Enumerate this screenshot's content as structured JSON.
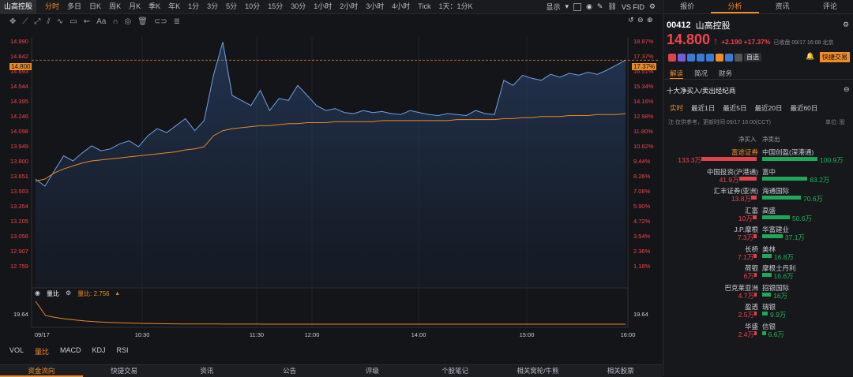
{
  "topbar": {
    "stock_title": "山高控股",
    "timeframes": [
      "分时",
      "多日",
      "日K",
      "周K",
      "月K",
      "季K",
      "年K",
      "1分",
      "3分",
      "5分",
      "10分",
      "15分",
      "30分",
      "1小时",
      "2小时",
      "3小时",
      "4小时",
      "Tick",
      "1天：1分K"
    ],
    "active_timeframe": "分时",
    "display_label": "显示",
    "vs_label": "VS FID"
  },
  "chart": {
    "price_ticks": [
      "14.990",
      "14.842",
      "14.693",
      "14.544",
      "14.395",
      "14.246",
      "14.098",
      "13.949",
      "13.800",
      "13.651",
      "13.503",
      "13.354",
      "13.205",
      "13.056",
      "12.907",
      "12.759"
    ],
    "pct_ticks": [
      "18.87%",
      "17.37%",
      "16.51%",
      "15.34%",
      "14.16%",
      "12.98%",
      "11.80%",
      "10.62%",
      "9.44%",
      "8.26%",
      "7.08%",
      "5.90%",
      "4.72%",
      "3.54%",
      "2.36%",
      "1.18%"
    ],
    "current_price_label": "14.800",
    "current_pct_label": "17.37%",
    "time_labels": [
      "09/17",
      "10:30",
      "11:30",
      "12:00",
      "14:00",
      "15:00",
      "16:00"
    ],
    "volume_ratio_label": "量比",
    "volume_ratio_value": "量比: 2.756",
    "sub_left_tick": "19.64",
    "sub_right_tick": "19.64",
    "indicator_tabs": [
      "VOL",
      "量比",
      "MACD",
      "KDJ",
      "RSI"
    ],
    "active_indicator": "量比"
  },
  "chart_data": {
    "type": "line",
    "ylim": [
      12.759,
      14.99
    ],
    "series": [
      {
        "values": [
          13.62,
          13.55,
          13.7,
          13.85,
          13.8,
          13.88,
          13.95,
          13.9,
          13.92,
          13.97,
          14.0,
          13.94,
          14.05,
          14.12,
          14.08,
          14.15,
          14.22,
          14.1,
          14.2,
          14.65,
          14.98,
          14.45,
          14.4,
          14.35,
          14.5,
          14.3,
          14.42,
          14.4,
          14.55,
          14.45,
          14.35,
          14.3,
          14.32,
          14.28,
          14.27,
          14.3,
          14.28,
          14.29,
          14.27,
          14.26,
          14.3,
          14.28,
          14.26,
          14.25,
          14.27,
          14.26,
          14.25,
          14.3,
          14.27,
          14.26,
          14.6,
          14.55,
          14.65,
          14.62,
          14.6,
          14.66,
          14.63,
          14.67,
          14.65,
          14.68,
          14.66,
          14.7,
          14.75,
          14.8
        ]
      },
      {
        "values": [
          13.6,
          13.62,
          13.68,
          13.72,
          13.75,
          13.78,
          13.8,
          13.81,
          13.82,
          13.83,
          13.84,
          13.85,
          13.86,
          13.87,
          13.88,
          13.89,
          13.91,
          13.92,
          13.94,
          14.05,
          14.1,
          14.12,
          14.13,
          14.14,
          14.15,
          14.15,
          14.16,
          14.17,
          14.17,
          14.18,
          14.18,
          14.18,
          14.19,
          14.19,
          14.19,
          14.19,
          14.19,
          14.2,
          14.2,
          14.2,
          14.2,
          14.2,
          14.2,
          14.2,
          14.2,
          14.21,
          14.21,
          14.21,
          14.21,
          14.21,
          14.22,
          14.22,
          14.23,
          14.23,
          14.24,
          14.24,
          14.24,
          14.25,
          14.25,
          14.25,
          14.26,
          14.26,
          14.26,
          14.27
        ]
      }
    ]
  },
  "right_panel": {
    "tabs": [
      "报价",
      "分析",
      "资讯",
      "评论"
    ],
    "active_tab": "分析",
    "code": "00412",
    "name": "山高控股",
    "price": "14.800",
    "change": "+2.190 +17.37%",
    "close_time": "已收盘 09/17 16:08 北京",
    "self_select": "自选",
    "quick_trade": "快捷交易",
    "sub_tabs": [
      "解读",
      "简况",
      "财务"
    ],
    "active_sub_tab": "解读",
    "section_title": "十大净买入/卖出经纪商",
    "period_tabs": [
      "实时",
      "最近1日",
      "最近5日",
      "最近20日",
      "最近60日"
    ],
    "note": "注:仅供参考，更新时间 09/17 16:00(CCT)",
    "unit_label": "单位: 股",
    "col_buy": "净买入",
    "col_sell": "净卖出",
    "brokers": [
      {
        "buyer": "富途证券",
        "buy_val": "133.3万",
        "buy_ratio": 1.0,
        "seller": "中国创盈(深港通)",
        "sell_val": "100.9万",
        "sell_ratio": 1.0,
        "highlight": true
      },
      {
        "buyer": "中国投资(沪港通)",
        "buy_val": "41.9万",
        "buy_ratio": 0.32,
        "seller": "富中",
        "sell_val": "83.2万",
        "sell_ratio": 0.82
      },
      {
        "buyer": "汇丰证券(亚洲)",
        "buy_val": "13.8万",
        "buy_ratio": 0.1,
        "seller": "海通国际",
        "sell_val": "70.6万",
        "sell_ratio": 0.7
      },
      {
        "buyer": "汇富",
        "buy_val": "10万",
        "buy_ratio": 0.075,
        "seller": "高盛",
        "sell_val": "50.6万",
        "sell_ratio": 0.5
      },
      {
        "buyer": "J.P.摩根",
        "buy_val": "7.3万",
        "buy_ratio": 0.055,
        "seller": "华富建业",
        "sell_val": "37.1万",
        "sell_ratio": 0.37
      },
      {
        "buyer": "长桥",
        "buy_val": "7.1万",
        "buy_ratio": 0.053,
        "seller": "美林",
        "sell_val": "16.8万",
        "sell_ratio": 0.17
      },
      {
        "buyer": "荷银",
        "buy_val": "6万",
        "buy_ratio": 0.045,
        "seller": "摩根士丹利",
        "sell_val": "16.6万",
        "sell_ratio": 0.165
      },
      {
        "buyer": "巴克莱亚洲",
        "buy_val": "4.7万",
        "buy_ratio": 0.035,
        "seller": "招银国际",
        "sell_val": "16万",
        "sell_ratio": 0.16
      },
      {
        "buyer": "盈透",
        "buy_val": "2.5万",
        "buy_ratio": 0.019,
        "seller": "瑞银",
        "sell_val": "9.9万",
        "sell_ratio": 0.1
      },
      {
        "buyer": "华盛",
        "buy_val": "2.4万",
        "buy_ratio": 0.018,
        "seller": "信银",
        "sell_val": "6.6万",
        "sell_ratio": 0.065
      }
    ]
  },
  "bottombar": {
    "tabs": [
      "资金流向",
      "快捷交易",
      "资讯",
      "公告",
      "评级",
      "个股笔记",
      "相关窝轮/牛熊",
      "相关股票"
    ],
    "active": "资金流向"
  },
  "colors": {
    "accent": "#f08c2a",
    "up": "#f0454d",
    "down": "#1fb35b",
    "price_line": "#5b8fd6",
    "avg_line": "#e8892a"
  }
}
